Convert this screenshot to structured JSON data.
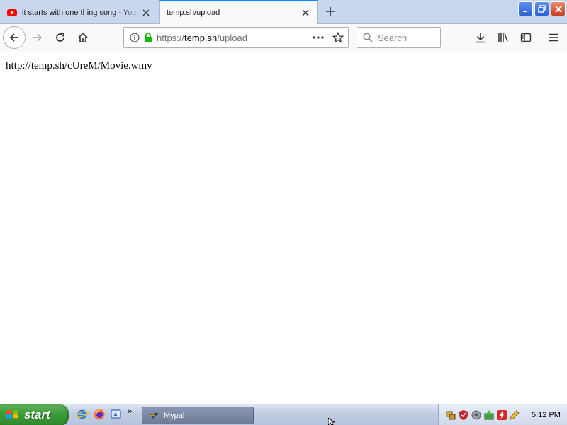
{
  "window": {
    "tabs": [
      {
        "title": "it starts with one thing song - YouTube",
        "favicon": "youtube-icon",
        "active": false
      },
      {
        "title": "temp.sh/upload",
        "favicon": "",
        "active": true
      }
    ]
  },
  "navbar": {
    "url_prefix": "https://",
    "url_host": "temp.sh",
    "url_path": "/upload",
    "search_placeholder": "Search"
  },
  "content": {
    "text": "http://temp.sh/cUreM/Movie.wmv"
  },
  "taskbar": {
    "start_label": "start",
    "quick_launch_more": "»",
    "task_label": "Mypal",
    "clock": "5:12 PM"
  },
  "colors": {
    "accent": "#0a84ff",
    "secure_lock": "#12bc00",
    "start_green": "#3c9a37"
  }
}
